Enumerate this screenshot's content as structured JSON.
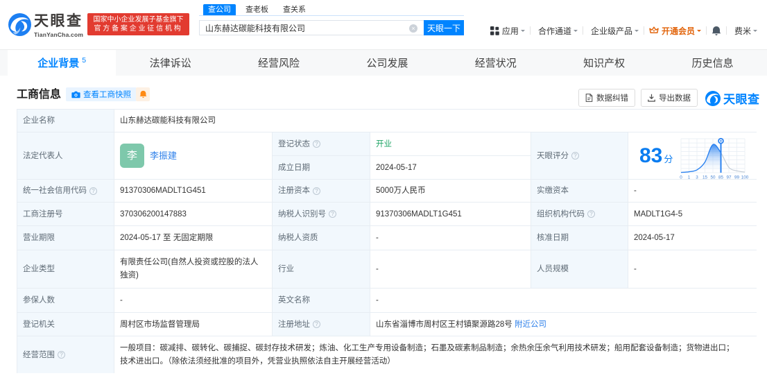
{
  "header": {
    "logo": {
      "brand": "天眼查",
      "domain": "TianYanCha.com"
    },
    "badge": {
      "line1": "国家中小企业发展子基金旗下",
      "line2": "官方备案企业征信机构"
    },
    "search": {
      "tabs": [
        {
          "label": "查公司",
          "active": true
        },
        {
          "label": "查老板",
          "active": false
        },
        {
          "label": "查关系",
          "active": false
        }
      ],
      "input_value": "山东赫达碳能科技有限公司",
      "clear_icon": "×",
      "button_label": "天眼一下"
    },
    "menu": [
      {
        "label": "应用",
        "icon": "apps-grid-icon",
        "dropdown": true
      },
      {
        "label": "合作通道",
        "dropdown": true
      },
      {
        "label": "企业级产品",
        "dropdown": true
      },
      {
        "label": "开通会员",
        "icon": "crown-icon",
        "dropdown": true,
        "color": "#e2660e"
      },
      {
        "label": "",
        "icon": "bell-icon"
      },
      {
        "label": "费米",
        "dropdown": true
      }
    ]
  },
  "nav_tabs": [
    {
      "label": "企业背景",
      "count": "5",
      "active": true
    },
    {
      "label": "法律诉讼",
      "active": false
    },
    {
      "label": "经营风险",
      "active": false
    },
    {
      "label": "公司发展",
      "active": false
    },
    {
      "label": "经营状况",
      "active": false
    },
    {
      "label": "知识产权",
      "active": false
    },
    {
      "label": "历史信息",
      "active": false
    }
  ],
  "section": {
    "title": "工商信息",
    "snapshot_button": "查看工商快照",
    "correction_button": "数据纠错",
    "export_button": "导出数据",
    "brand": "天眼查"
  },
  "company": {
    "company_name": {
      "label": "企业名称",
      "value": "山东赫达碳能科技有限公司"
    },
    "legal_rep": {
      "label": "法定代表人",
      "value": "李振建",
      "avatar_text": "李"
    },
    "reg_status": {
      "label": "登记状态",
      "value": "开业"
    },
    "establish_date": {
      "label": "成立日期",
      "value": "2024-05-17"
    },
    "score": {
      "label": "天眼评分",
      "value": "83",
      "unit": "分"
    },
    "credit_code": {
      "label": "统一社会信用代码",
      "value": "91370306MADLT1G451"
    },
    "reg_capital": {
      "label": "注册资本",
      "value": "5000万人民币"
    },
    "paid_capital": {
      "label": "实缴资本",
      "value": "-"
    },
    "reg_no": {
      "label": "工商注册号",
      "value": "370306200147883"
    },
    "taxpayer_no": {
      "label": "纳税人识别号",
      "value": "91370306MADLT1G451"
    },
    "org_code": {
      "label": "组织机构代码",
      "value": "MADLT1G4-5"
    },
    "biz_term": {
      "label": "营业期限",
      "value": "2024-05-17 至 无固定期限"
    },
    "taxpayer_quality": {
      "label": "纳税人资质",
      "value": "-"
    },
    "approval_date": {
      "label": "核准日期",
      "value": "2024-05-17"
    },
    "company_type": {
      "label": "企业类型",
      "value": "有限责任公司(自然人投资或控股的法人独资)"
    },
    "industry": {
      "label": "行业",
      "value": "-"
    },
    "staff_size": {
      "label": "人员规模",
      "value": "-"
    },
    "insured_num": {
      "label": "参保人数",
      "value": "-"
    },
    "english_name": {
      "label": "英文名称",
      "value": "-"
    },
    "reg_authority": {
      "label": "登记机关",
      "value": "周村区市场监督管理局"
    },
    "address": {
      "label": "注册地址",
      "value": "山东省淄博市周村区王村镇聚源路28号",
      "nearby_link": "附近公司"
    },
    "biz_scope": {
      "label": "经营范围",
      "value": "一般项目：碳减排、碳转化、碳捕捉、碳封存技术研发；炼油、化工生产专用设备制造；石墨及碳素制品制造；余热余压余气利用技术研发；船用配套设备制造；货物进出口；技术进出口。（除依法须经批准的项目外，凭营业执照依法自主开展经营活动）"
    }
  },
  "chart_data": {
    "type": "area",
    "title": "天眼评分",
    "score": 83,
    "score_unit": "分",
    "x_ticks": [
      "0",
      "1",
      "3",
      "15",
      "50",
      "85",
      "97",
      "99",
      "100"
    ],
    "curve_heights": [
      0.01,
      0.03,
      0.09,
      0.34,
      0.9,
      0.64,
      0.17,
      0.06,
      0.02
    ],
    "marker_tick": "85",
    "grid": true,
    "legend": "none",
    "accent_color": "#2b82f0",
    "tail_color": "#c3ccd6"
  },
  "colors": {
    "brand_blue": "#0084ff",
    "link_blue": "#2f81ea",
    "status_green": "#21a567",
    "avatar_green": "#7ec8ab",
    "badge_red": "#e23b30",
    "vip_orange": "#e2660e",
    "monitor_orange": "#fe8a14",
    "label_bg": "#f2f8fd",
    "table_border": "#e7edf3"
  }
}
